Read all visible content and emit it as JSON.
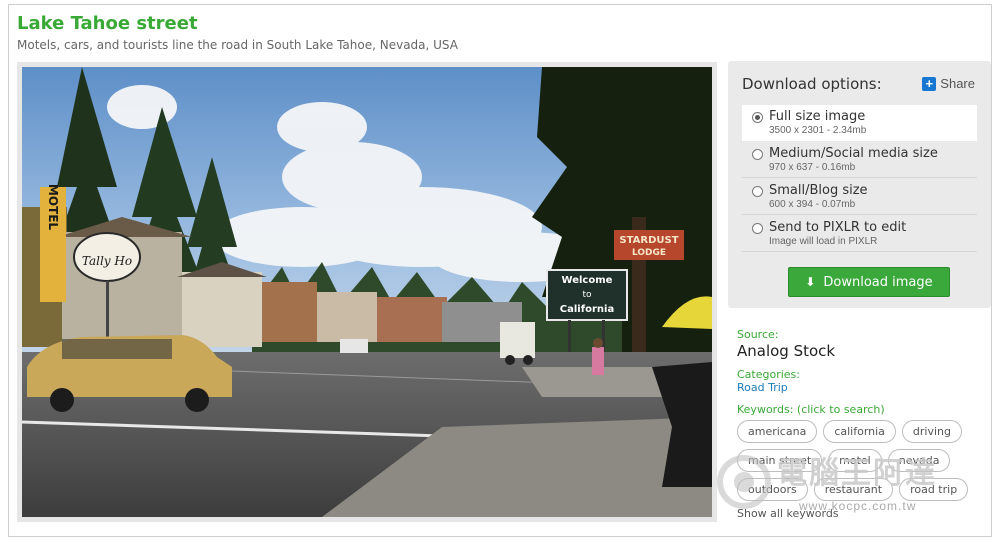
{
  "page": {
    "title": "Lake Tahoe street",
    "subtitle": "Motels, cars, and tourists line the road in South Lake Tahoe, Nevada, USA"
  },
  "photo": {
    "signs": {
      "motel": "MOTEL",
      "tally_ho": "Tally Ho",
      "welcome_line1": "Welcome",
      "welcome_line2": "to",
      "welcome_line3": "California",
      "stardust": "STARDUST",
      "lodge": "LODGE"
    }
  },
  "download": {
    "title": "Download options:",
    "share_label": "Share",
    "options": [
      {
        "label": "Full size image",
        "meta": "3500 x 2301 - 2.34mb",
        "selected": true
      },
      {
        "label": "Medium/Social media size",
        "meta": "970 x 637 - 0.16mb",
        "selected": false
      },
      {
        "label": "Small/Blog size",
        "meta": "600 x 394 - 0.07mb",
        "selected": false
      },
      {
        "label": "Send to PIXLR to edit",
        "meta": "Image will load in PIXLR",
        "selected": false
      }
    ],
    "button_label": "Download image"
  },
  "info": {
    "source_label": "Source:",
    "source_value": "Analog Stock",
    "categories_label": "Categories:",
    "categories_value": "Road Trip",
    "keywords_label": "Keywords: (click to search)",
    "keywords": [
      "americana",
      "california",
      "driving",
      "main street",
      "motel",
      "nevada",
      "outdoors",
      "restaurant",
      "road trip"
    ],
    "show_all": "Show all keywords"
  },
  "watermark": {
    "text": "電腦王阿達",
    "url": "www.kocpc.com.tw"
  },
  "colors": {
    "accent_green": "#39a935",
    "button_green": "#3aa83a",
    "link_blue": "#1a7bb8",
    "share_blue": "#1877d2"
  }
}
